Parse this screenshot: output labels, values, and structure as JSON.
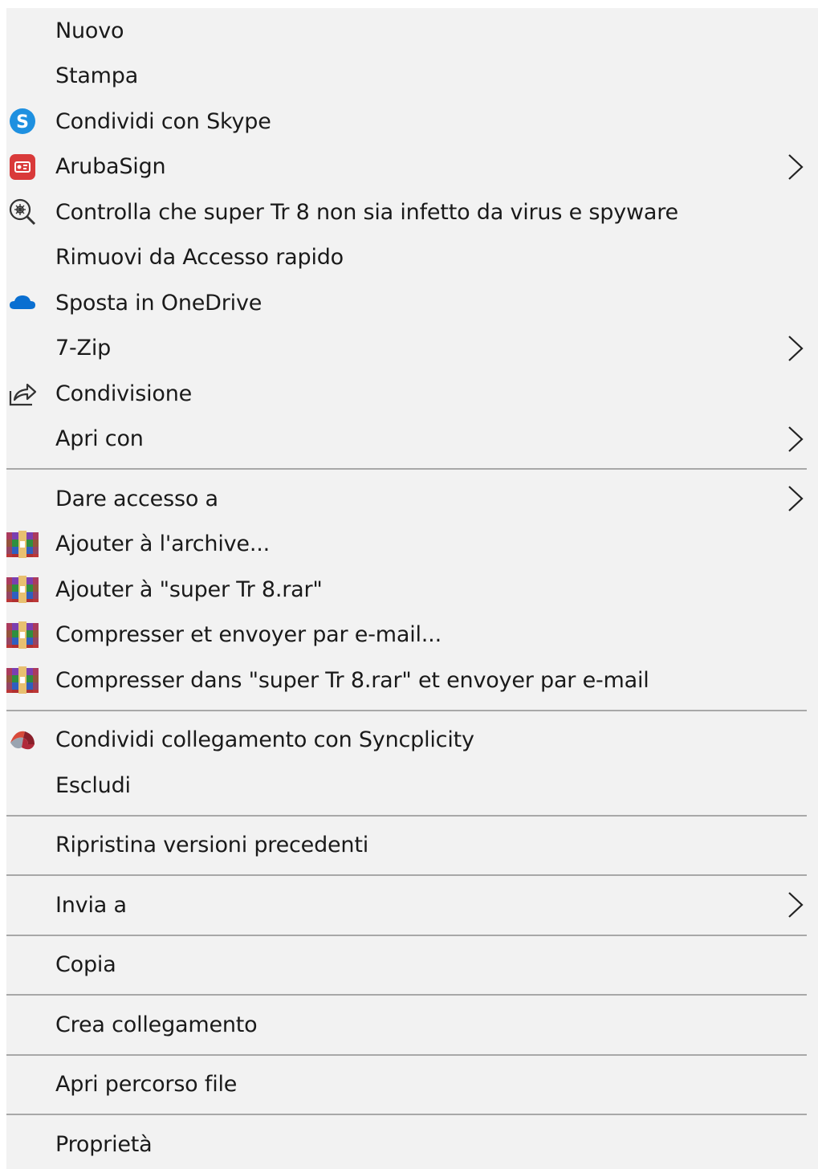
{
  "menu": {
    "items": [
      {
        "label": "Nuovo",
        "icon": null,
        "submenu": false
      },
      {
        "label": "Stampa",
        "icon": null,
        "submenu": false
      },
      {
        "label": "Condividi con Skype",
        "icon": "skype-icon",
        "submenu": false
      },
      {
        "label": "ArubaSign",
        "icon": "arubasign-icon",
        "submenu": true
      },
      {
        "label": "Controlla che super Tr 8 non sia infetto da virus e spyware",
        "icon": "virus-scan-icon",
        "submenu": false
      },
      {
        "label": "Rimuovi da Accesso rapido",
        "icon": null,
        "submenu": false
      },
      {
        "label": "Sposta in OneDrive",
        "icon": "onedrive-icon",
        "submenu": false
      },
      {
        "label": "7-Zip",
        "icon": null,
        "submenu": true
      },
      {
        "label": "Condivisione",
        "icon": "share-icon",
        "submenu": false
      },
      {
        "label": "Apri con",
        "icon": null,
        "submenu": true
      },
      {
        "separator": true
      },
      {
        "label": "Dare accesso a",
        "icon": null,
        "submenu": true
      },
      {
        "label": "Ajouter à l'archive...",
        "icon": "winrar-icon",
        "submenu": false
      },
      {
        "label": "Ajouter à \"super Tr 8.rar\"",
        "icon": "winrar-icon",
        "submenu": false
      },
      {
        "label": "Compresser et envoyer par e-mail...",
        "icon": "winrar-icon",
        "submenu": false
      },
      {
        "label": "Compresser dans \"super Tr 8.rar\" et envoyer par e-mail",
        "icon": "winrar-icon",
        "submenu": false
      },
      {
        "separator": true
      },
      {
        "label": "Condividi collegamento con Syncplicity",
        "icon": "syncplicity-icon",
        "submenu": false
      },
      {
        "label": "Escludi",
        "icon": null,
        "submenu": false
      },
      {
        "separator": true
      },
      {
        "label": "Ripristina versioni precedenti",
        "icon": null,
        "submenu": false
      },
      {
        "separator": true
      },
      {
        "label": "Invia a",
        "icon": null,
        "submenu": true
      },
      {
        "separator": true
      },
      {
        "label": "Copia",
        "icon": null,
        "submenu": false
      },
      {
        "separator": true
      },
      {
        "label": "Crea collegamento",
        "icon": null,
        "submenu": false
      },
      {
        "separator": true
      },
      {
        "label": "Apri percorso file",
        "icon": null,
        "submenu": false
      },
      {
        "separator": true
      },
      {
        "label": "Proprietà",
        "icon": null,
        "submenu": false
      }
    ],
    "colors": {
      "background": "#f2f2f2",
      "separator": "#a8a8a8",
      "text": "#1a1a1a",
      "skype": "#1e90e0",
      "arubasign": "#d93a3a",
      "onedrive": "#0a6fd1"
    }
  }
}
